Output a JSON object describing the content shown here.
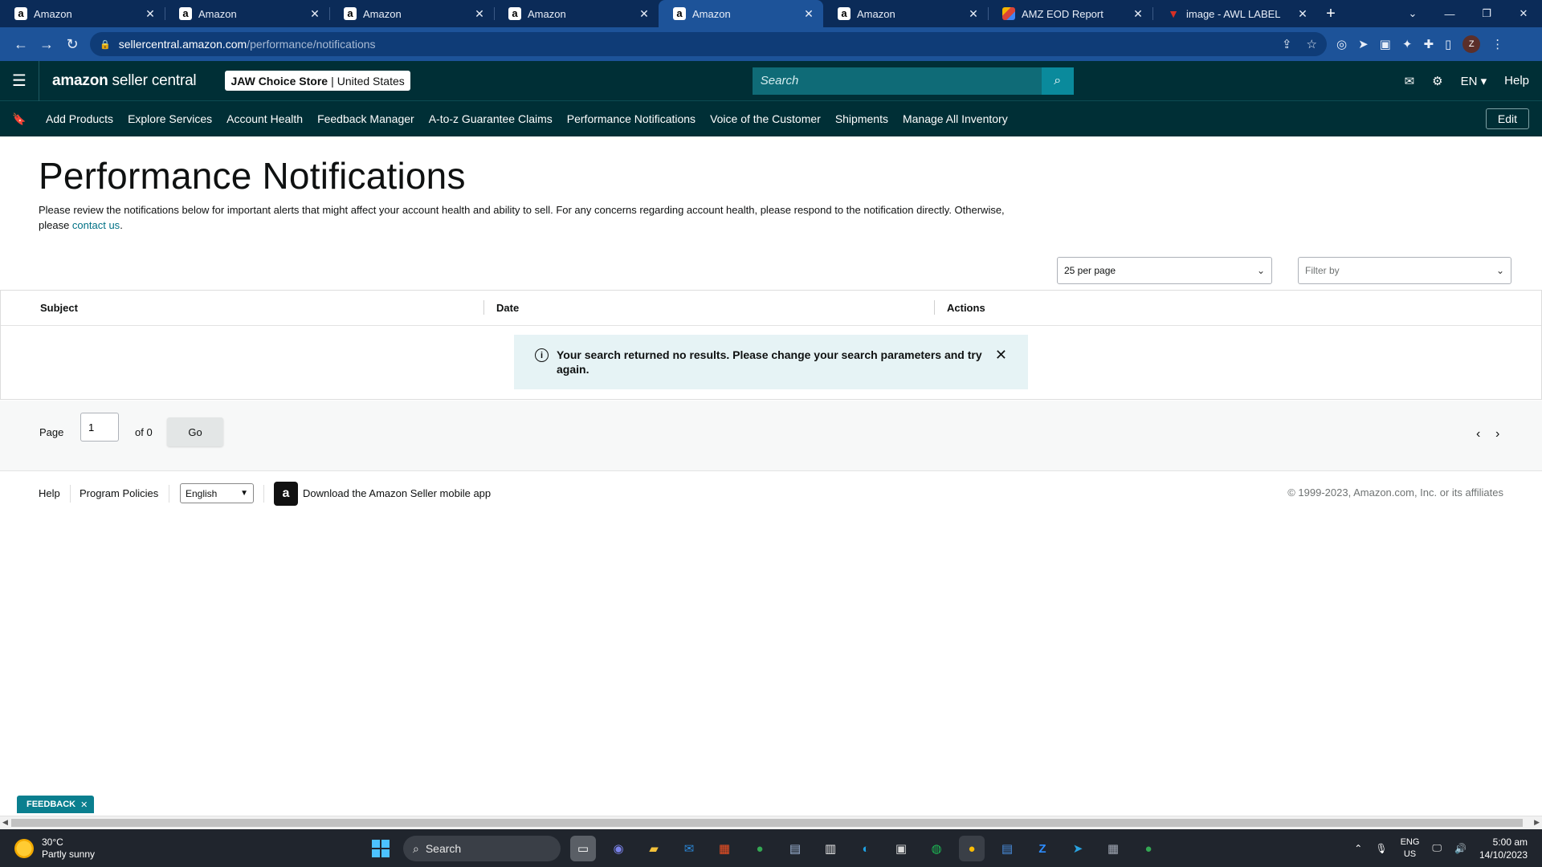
{
  "browser": {
    "tabs": [
      {
        "title": "Amazon",
        "favicon": "amazon-icon",
        "active": false
      },
      {
        "title": "Amazon",
        "favicon": "amazon-icon",
        "active": false
      },
      {
        "title": "Amazon",
        "favicon": "amazon-icon",
        "active": false
      },
      {
        "title": "Amazon",
        "favicon": "amazon-icon",
        "active": false
      },
      {
        "title": "Amazon",
        "favicon": "amazon-icon",
        "active": true
      },
      {
        "title": "Amazon",
        "favicon": "amazon-icon",
        "active": false
      },
      {
        "title": "AMZ EOD Report",
        "favicon": "sheets-icon",
        "active": false
      },
      {
        "title": "image - AWL LABEL",
        "favicon": "awl-icon",
        "active": false
      }
    ],
    "url_host": "sellercentral.amazon.com",
    "url_path": "/performance/notifications",
    "profile_initial": "Z",
    "colors": {
      "tabstrip": "#0b2b58",
      "active_tab": "#1d5399"
    }
  },
  "header": {
    "logo_brand": "amazon",
    "logo_product": "seller central",
    "store_name": "JAW Choice Store",
    "store_region": "United States",
    "search_placeholder": "Search",
    "language": "EN",
    "help": "Help",
    "colors": {
      "background": "#002f36",
      "search_button": "#0a8a9c"
    }
  },
  "nav": {
    "links": [
      "Add Products",
      "Explore Services",
      "Account Health",
      "Feedback Manager",
      "A-to-z Guarantee Claims",
      "Performance Notifications",
      "Voice of the Customer",
      "Shipments",
      "Manage All Inventory"
    ],
    "edit_label": "Edit"
  },
  "main": {
    "title": "Performance Notifications",
    "intro_text": "Please review the notifications below for important alerts that might affect your account health and ability to sell. For any concerns regarding account health, please respond to the notification directly. Otherwise, please ",
    "intro_link": "contact us",
    "intro_end": ".",
    "per_page_selected": "25 per page",
    "filter_placeholder": "Filter by",
    "columns": [
      "Subject",
      "Date",
      "Actions"
    ],
    "alert_message": "Your search returned no results. Please change your search parameters and try again.",
    "pager": {
      "page_label": "Page",
      "page_value": "1",
      "of_label": "of 0",
      "go_label": "Go"
    }
  },
  "footer": {
    "help": "Help",
    "program_policies": "Program Policies",
    "language": "English",
    "app_text": "Download the Amazon Seller mobile app",
    "copyright": "© 1999-2023, Amazon.com, Inc. or its affiliates",
    "feedback_label": "FEEDBACK"
  },
  "taskbar": {
    "weather_temp": "30°C",
    "weather_desc": "Partly sunny",
    "search_label": "Search",
    "lang_line1": "ENG",
    "lang_line2": "US",
    "time": "5:00 am",
    "date": "14/10/2023"
  }
}
